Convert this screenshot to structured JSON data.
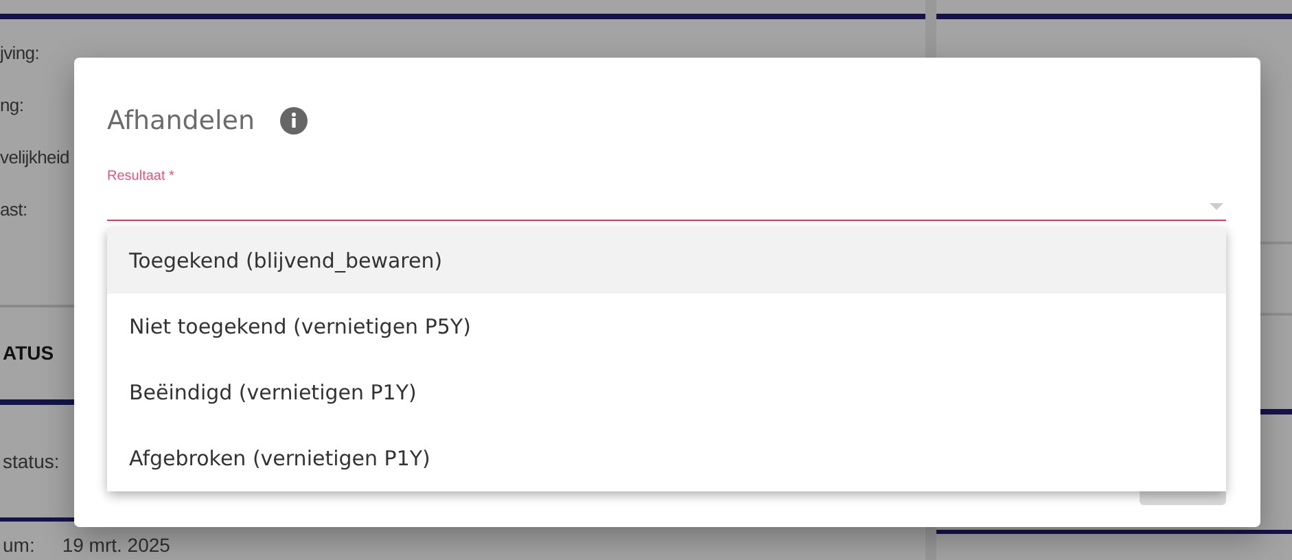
{
  "background": {
    "fields_top": [
      {
        "label": "jving:"
      },
      {
        "label": "ng:"
      },
      {
        "label": "velijkheid"
      },
      {
        "label": "ast:"
      }
    ],
    "section_heading": "ATUS",
    "fields_bottom": [
      {
        "label": "status:"
      },
      {
        "label": "um:",
        "value": "19 mrt. 2025"
      }
    ]
  },
  "dialog": {
    "title": "Afhandelen",
    "field": {
      "label": "Resultaat *",
      "options": [
        {
          "label": "Toegekend (blijvend_bewaren)",
          "selected": true
        },
        {
          "label": "Niet toegekend (vernietigen P5Y)",
          "selected": false
        },
        {
          "label": "Beëindigd (vernietigen P1Y)",
          "selected": false
        },
        {
          "label": "Afgebroken (vernietigen P1Y)",
          "selected": false
        }
      ]
    }
  }
}
